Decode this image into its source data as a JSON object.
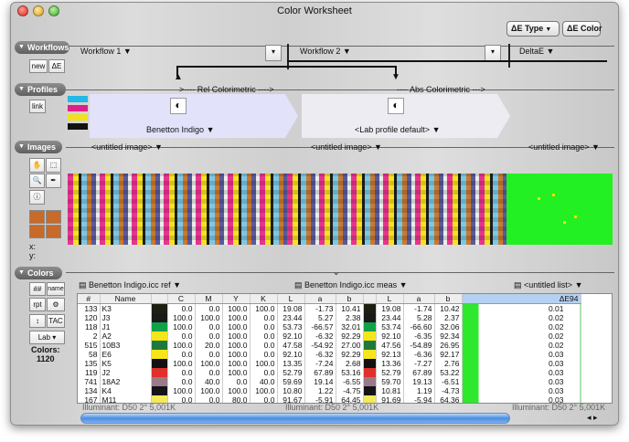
{
  "window": {
    "title": "Color Worksheet"
  },
  "toolbar": {
    "de_type": "ΔE Type",
    "de_color": "ΔE Color"
  },
  "workflows": {
    "header": "Workflows",
    "new": "new",
    "delta": "ΔE",
    "wf1": "Workflow 1",
    "wf2": "Workflow 2",
    "deltae": "DeltaE"
  },
  "profiles": {
    "header": "Profiles",
    "link": "link",
    "rel": ">---- Rel Colorimetric ---->",
    "abs": "---- Abs Colorimetric --->",
    "p1": "Benetton Indigo",
    "p2": "<Lab profile default>"
  },
  "images": {
    "header": "Images",
    "untitled1": "<untitled image>",
    "untitled2": "<untitled image>",
    "untitled3": "<untitled image>",
    "x": "x:",
    "y": "y:"
  },
  "colors": {
    "header": "Colors",
    "hash": "##",
    "name": "name",
    "rpt": "rpt",
    "tac": "TAC",
    "lab": "Lab",
    "count_label": "Colors:",
    "count": "1120",
    "list1": "Benetton Indigo.icc ref",
    "list2": "Benetton Indigo.icc meas",
    "list3": "<untitled list>",
    "columns": [
      "#",
      "Name",
      "",
      "C",
      "M",
      "Y",
      "K",
      "L",
      "a",
      "b",
      "",
      "L",
      "a",
      "b",
      "ΔE94"
    ],
    "rows": [
      {
        "n": "133",
        "name": "K3",
        "c": "0.0",
        "m": "0.0",
        "y": "100.0",
        "k": "100.0",
        "L": "19.08",
        "a": "-1.73",
        "b": "10.41",
        "L2": "19.08",
        "a2": "-1.74",
        "b2": "10.42",
        "de": "0.01",
        "sw": "#1e1e12"
      },
      {
        "n": "120",
        "name": "J3",
        "c": "100.0",
        "m": "100.0",
        "y": "100.0",
        "k": "0.0",
        "L": "23.44",
        "a": "5.27",
        "b": "2.38",
        "L2": "23.44",
        "a2": "5.28",
        "b2": "2.37",
        "de": "0.02",
        "sw": "#1a1a1a"
      },
      {
        "n": "118",
        "name": "J1",
        "c": "100.0",
        "m": "0.0",
        "y": "100.0",
        "k": "0.0",
        "L": "53.73",
        "a": "-66.57",
        "b": "32.01",
        "L2": "53.74",
        "a2": "-66.60",
        "b2": "32.06",
        "de": "0.02",
        "sw": "#12a04a"
      },
      {
        "n": "2",
        "name": "A2",
        "c": "0.0",
        "m": "0.0",
        "y": "100.0",
        "k": "0.0",
        "L": "92.10",
        "a": "-6.32",
        "b": "92.29",
        "L2": "92.10",
        "a2": "-6.35",
        "b2": "92.34",
        "de": "0.02",
        "sw": "#f7e51a"
      },
      {
        "n": "515",
        "name": "10B3",
        "c": "100.0",
        "m": "20.0",
        "y": "100.0",
        "k": "0.0",
        "L": "47.58",
        "a": "-54.92",
        "b": "27.00",
        "L2": "47.56",
        "a2": "-54.89",
        "b2": "26.95",
        "de": "0.02",
        "sw": "#1e7a3a"
      },
      {
        "n": "58",
        "name": "E6",
        "c": "0.0",
        "m": "0.0",
        "y": "100.0",
        "k": "0.0",
        "L": "92.10",
        "a": "-6.32",
        "b": "92.29",
        "L2": "92.13",
        "a2": "-6.36",
        "b2": "92.17",
        "de": "0.03",
        "sw": "#f7e51a"
      },
      {
        "n": "135",
        "name": "K5",
        "c": "100.0",
        "m": "100.0",
        "y": "100.0",
        "k": "100.0",
        "L": "13.35",
        "a": "-7.24",
        "b": "2.68",
        "L2": "13.36",
        "a2": "-7.27",
        "b2": "2.76",
        "de": "0.03",
        "sw": "#111"
      },
      {
        "n": "119",
        "name": "J2",
        "c": "0.0",
        "m": "0.0",
        "y": "100.0",
        "k": "0.0",
        "L": "52.79",
        "a": "67.89",
        "b": "53.16",
        "L2": "52.79",
        "a2": "67.89",
        "b2": "53.22",
        "de": "0.03",
        "sw": "#e0302a"
      },
      {
        "n": "741",
        "name": "18A2",
        "c": "0.0",
        "m": "40.0",
        "y": "0.0",
        "k": "40.0",
        "L": "59.69",
        "a": "19.14",
        "b": "-6.55",
        "L2": "59.70",
        "a2": "19.13",
        "b2": "-6.51",
        "de": "0.03",
        "sw": "#9a7a8a"
      },
      {
        "n": "134",
        "name": "K4",
        "c": "100.0",
        "m": "100.0",
        "y": "100.0",
        "k": "100.0",
        "L": "10.80",
        "a": "1.22",
        "b": "-4.75",
        "L2": "10.81",
        "a2": "1.19",
        "b2": "-4.73",
        "de": "0.03",
        "sw": "#151218"
      },
      {
        "n": "167",
        "name": "M11",
        "c": "0.0",
        "m": "0.0",
        "y": "80.0",
        "k": "0.0",
        "L": "91.67",
        "a": "-5.91",
        "b": "64.45",
        "L2": "91.69",
        "a2": "-5.94",
        "b2": "64.36",
        "de": "0.03",
        "sw": "#f3ea5a"
      }
    ],
    "illum1": "Illuminant: D50 2° 5,001K",
    "illum2": "Illuminant: D50 2° 5,001K",
    "illum3": "Illuminant: D50 2° 5,001K"
  }
}
